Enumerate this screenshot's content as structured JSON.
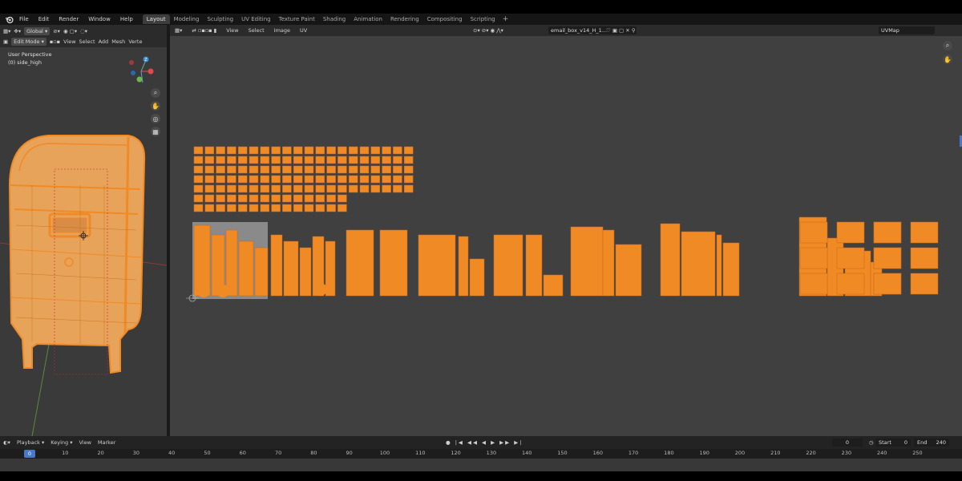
{
  "menu": {
    "items": [
      "File",
      "Edit",
      "Render",
      "Window",
      "Help"
    ]
  },
  "workspaces": {
    "tabs": [
      "Layout",
      "Modeling",
      "Sculpting",
      "UV Editing",
      "Texture Paint",
      "Shading",
      "Animation",
      "Rendering",
      "Compositing",
      "Scripting"
    ],
    "active": "Layout",
    "add_label": "+"
  },
  "viewport": {
    "mode": "Edit Mode",
    "transform_orientation": "Global",
    "menu": [
      "View",
      "Select",
      "Add",
      "Mesh",
      "Verte"
    ],
    "view_name": "User Perspective",
    "object_name": "(0) side_high",
    "axis_labels": {
      "x": "X",
      "y": "Y",
      "z": "Z"
    }
  },
  "uv_editor": {
    "menu": [
      "View",
      "Select",
      "Image",
      "UV"
    ],
    "image_name": "email_box_v14_H_1...",
    "uv_map": "UVMap"
  },
  "timeline": {
    "menu": [
      "Playback",
      "Keying",
      "View",
      "Marker"
    ],
    "current_frame": "0",
    "frame_field": "0",
    "start_label": "Start",
    "start_value": "0",
    "end_label": "End",
    "end_value": "240",
    "ticks": [
      "0",
      "10",
      "20",
      "30",
      "40",
      "50",
      "60",
      "70",
      "80",
      "90",
      "100",
      "110",
      "120",
      "130",
      "140",
      "150",
      "160",
      "170",
      "180",
      "190",
      "200",
      "210",
      "220",
      "230",
      "240",
      "250"
    ]
  },
  "colors": {
    "accent": "#4a78c8",
    "uv_orange": "#f08a24",
    "mesh_orange": "#f39a3a"
  }
}
